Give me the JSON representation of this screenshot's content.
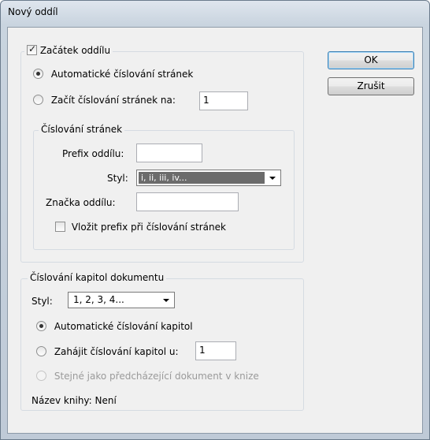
{
  "window": {
    "title": "Nový oddíl"
  },
  "buttons": {
    "ok": "OK",
    "cancel": "Zrušit"
  },
  "section_start": {
    "label": "Začátek oddílu",
    "checked": true,
    "auto_numbering": "Automatické číslování stránek",
    "start_numbering": "Začít číslování stránek na:",
    "start_value": "1"
  },
  "page_numbering": {
    "legend": "Číslování stránek",
    "prefix_label": "Prefix oddílu:",
    "prefix_value": "",
    "style_label": "Styl:",
    "style_value": "i, ii, iii, iv...",
    "marker_label": "Značka oddílu:",
    "marker_value": "",
    "include_prefix": "Vložit prefix při číslování stránek"
  },
  "chapter_numbering": {
    "legend": "Číslování kapitol dokumentu",
    "style_label": "Styl:",
    "style_value": "1, 2, 3, 4...",
    "auto_chapter": "Automatické číslování kapitol",
    "start_chapter": "Zahájit číslování kapitol u:",
    "start_value": "1",
    "same_as_previous": "Stejné jako předcházející dokument v knize",
    "book_name": "Název knihy: Není"
  }
}
